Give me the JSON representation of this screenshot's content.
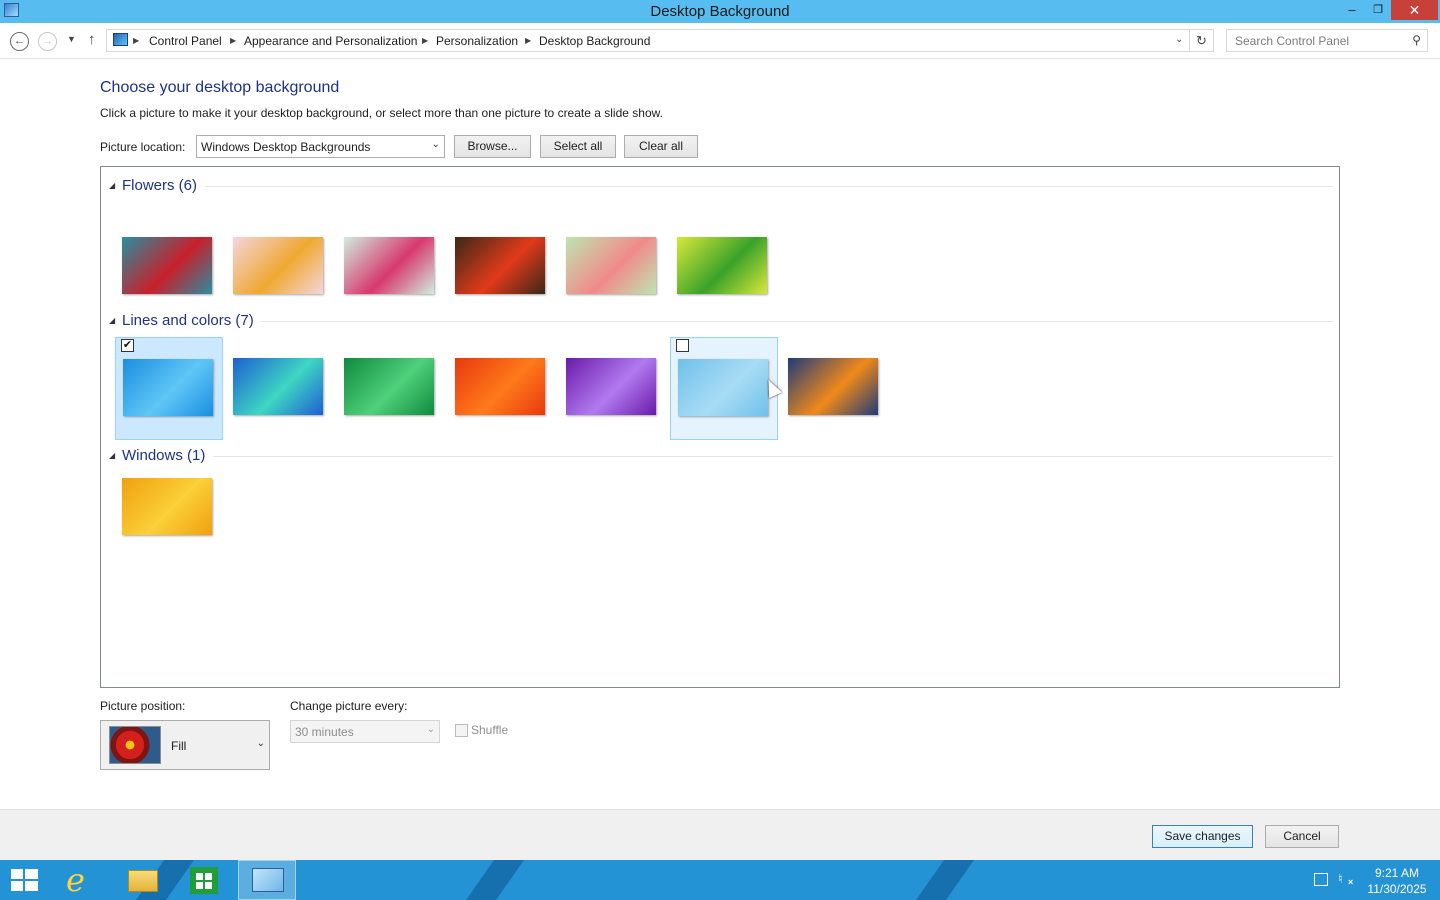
{
  "window": {
    "title": "Desktop Background"
  },
  "address": {
    "breadcrumbs": [
      "Control Panel",
      "Appearance and Personalization",
      "Personalization",
      "Desktop Background"
    ],
    "search_placeholder": "Search Control Panel"
  },
  "main": {
    "heading": "Choose your desktop background",
    "subtext": "Click a picture to make it your desktop background, or select more than one picture to create a slide show.",
    "location_label": "Picture location:",
    "location_value": "Windows Desktop Backgrounds",
    "browse_label": "Browse...",
    "select_all_label": "Select all",
    "clear_all_label": "Clear all"
  },
  "groups": [
    {
      "title": "Flowers (6)",
      "items": [
        {
          "colors": [
            "#2a8ea0",
            "#c8202a"
          ],
          "checked": false
        },
        {
          "colors": [
            "#f4d6dd",
            "#f0a830"
          ],
          "checked": false
        },
        {
          "colors": [
            "#cfeee0",
            "#d8386e"
          ],
          "checked": false
        },
        {
          "colors": [
            "#3a2818",
            "#e23a1a"
          ],
          "checked": false
        },
        {
          "colors": [
            "#bde6b0",
            "#f08a8a"
          ],
          "checked": false
        },
        {
          "colors": [
            "#d8e83a",
            "#3aa22a"
          ],
          "checked": false
        }
      ]
    },
    {
      "title": "Lines and colors (7)",
      "items": [
        {
          "colors": [
            "#1a8ee0",
            "#5fc6f6"
          ],
          "checked": true
        },
        {
          "colors": [
            "#1e5fd2",
            "#3ed6c2"
          ],
          "checked": false
        },
        {
          "colors": [
            "#0f8a3e",
            "#4fd07a"
          ],
          "checked": false
        },
        {
          "colors": [
            "#e8380e",
            "#ff7a1a"
          ],
          "checked": false
        },
        {
          "colors": [
            "#6a1aa8",
            "#b17af0"
          ],
          "checked": false
        },
        {
          "colors": [
            "#6fc0ea",
            "#a9dcf5"
          ],
          "checked": false
        },
        {
          "colors": [
            "#1f3a7a",
            "#f08a1a"
          ],
          "checked": false
        }
      ]
    },
    {
      "title": "Windows (1)",
      "items": [
        {
          "colors": [
            "#f0a010",
            "#fbd038"
          ],
          "checked": false
        }
      ]
    }
  ],
  "options": {
    "position_label": "Picture position:",
    "position_value": "Fill",
    "change_label": "Change picture every:",
    "interval_value": "30 minutes",
    "shuffle_label": "Shuffle"
  },
  "footer": {
    "save_label": "Save changes",
    "cancel_label": "Cancel"
  },
  "taskbar": {
    "time": "9:21 AM",
    "date": "11/30/2025"
  }
}
